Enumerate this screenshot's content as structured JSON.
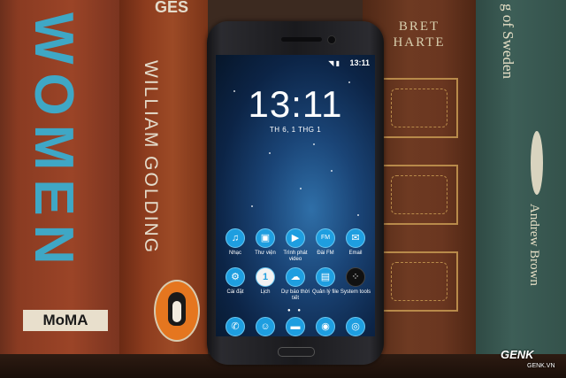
{
  "books": {
    "women": {
      "title": "WOMEN",
      "label": "MoMA"
    },
    "golding": {
      "top_text": "GES",
      "author": "WILLIAM GOLDING"
    },
    "harte": {
      "line1": "BRET",
      "line2": "HARTE"
    },
    "sweden": {
      "title": "g of Sweden",
      "author": "Andrew Brown"
    }
  },
  "phone": {
    "status": {
      "icons": "◥ ▮",
      "time": "13:11"
    },
    "clock": "13:11",
    "date": "TH 6, 1 THG 1",
    "apps": [
      {
        "label": "Nhạc",
        "icon": "music-icon",
        "glyph": "♫"
      },
      {
        "label": "Thư viện",
        "icon": "gallery-icon",
        "glyph": "▣"
      },
      {
        "label": "Trình phát video",
        "icon": "video-player-icon",
        "glyph": "▶"
      },
      {
        "label": "Đài FM",
        "icon": "radio-icon",
        "glyph": "FM"
      },
      {
        "label": "Email",
        "icon": "email-icon",
        "glyph": "✉"
      },
      {
        "label": "Cài đặt",
        "icon": "settings-icon",
        "glyph": "⚙"
      },
      {
        "label": "Lịch",
        "icon": "calendar-icon",
        "glyph": "1"
      },
      {
        "label": "Dự báo thời tiết",
        "icon": "weather-icon",
        "glyph": "☁"
      },
      {
        "label": "Quản lý file",
        "icon": "file-manager-icon",
        "glyph": "▤"
      },
      {
        "label": "System tools",
        "icon": "system-tools-icon",
        "glyph": "⁘"
      }
    ],
    "dock": [
      {
        "icon": "phone-icon",
        "glyph": "✆"
      },
      {
        "icon": "contacts-icon",
        "glyph": "☺"
      },
      {
        "icon": "messages-icon",
        "glyph": "▬"
      },
      {
        "icon": "camera-icon",
        "glyph": "◉"
      },
      {
        "icon": "browser-icon",
        "glyph": "◎"
      }
    ]
  },
  "watermark": {
    "logo": "GENK",
    "url": "GENK.VN"
  }
}
